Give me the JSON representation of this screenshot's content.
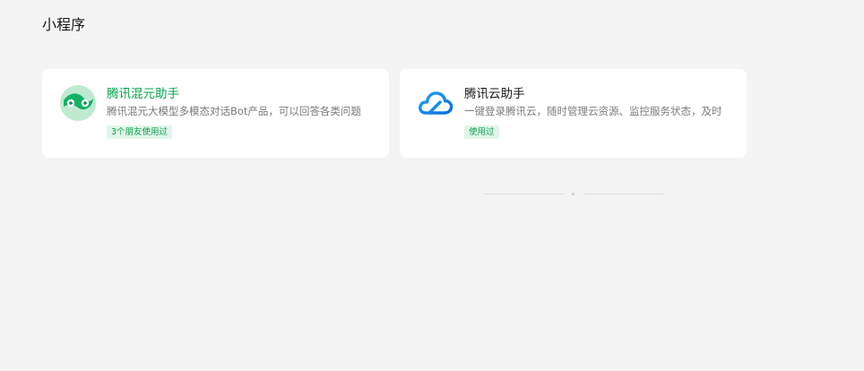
{
  "section": {
    "title": "小程序"
  },
  "colors": {
    "background": "#f4f4f4",
    "card": "#ffffff",
    "highlight_name": "#07a34e",
    "tag_bg": "#e3f5ea",
    "tag_text": "#07a34e"
  },
  "cards": [
    {
      "name": "腾讯混元助手",
      "description": "腾讯混元大模型多模态对话Bot产品，可以回答各类问题",
      "tag": "3个朋友使用过",
      "icon": "hunyuan-logo-icon",
      "name_highlighted": true
    },
    {
      "name": "腾讯云助手",
      "description": "一键登录腾讯云，随时管理云资源、监控服务状态，及时",
      "tag": "使用过",
      "icon": "tencent-cloud-logo-icon",
      "name_highlighted": false
    }
  ]
}
